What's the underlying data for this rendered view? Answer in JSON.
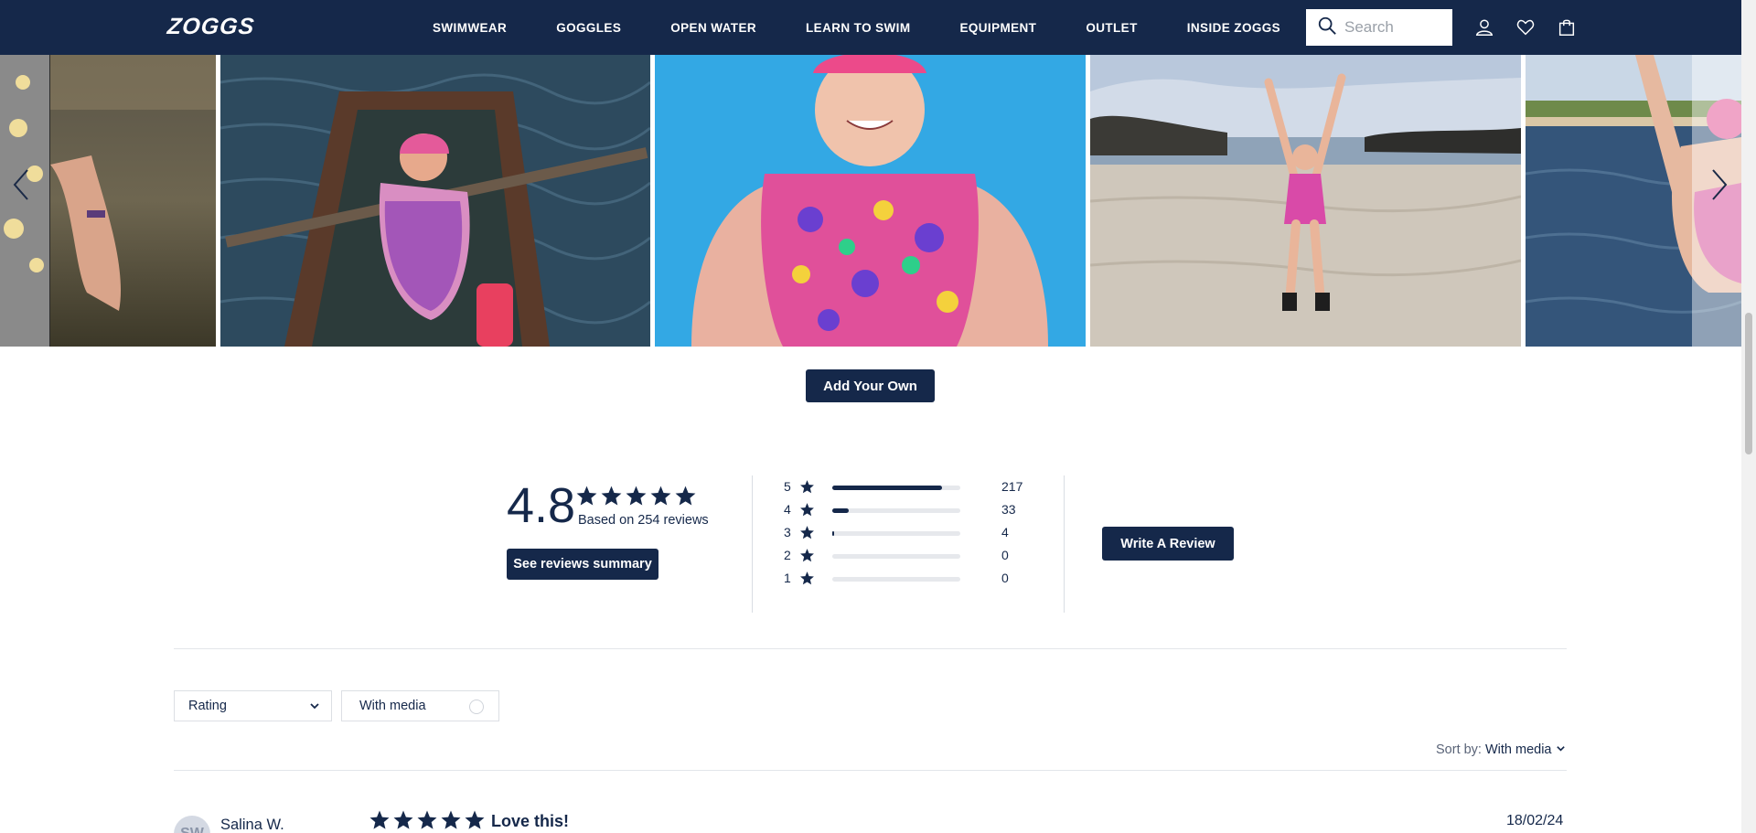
{
  "nav": {
    "logo": "ZOGGS",
    "links": [
      "SWIMWEAR",
      "GOGGLES",
      "OPEN WATER",
      "LEARN TO SWIM",
      "EQUIPMENT",
      "OUTLET",
      "INSIDE ZOGGS"
    ],
    "search_placeholder": "Search",
    "icons": [
      "account-icon",
      "wishlist-heart-icon",
      "bag-icon"
    ]
  },
  "gallery": {
    "add_your_own": "Add Your Own",
    "photos": [
      "customer-photo-1",
      "customer-photo-2",
      "customer-photo-3",
      "customer-photo-4",
      "customer-photo-5"
    ],
    "colors": {
      "water_dark": "#2d4a5e",
      "pool_blue": "#2fa3e0",
      "sky": "#b9c8dc",
      "sand": "#cfc7bb",
      "swimsuit_pink": "#e0509a"
    }
  },
  "summary": {
    "average": "4.8",
    "stars": 5,
    "based_on": "Based on 254 reviews",
    "see_summary": "See reviews summary",
    "write_review": "Write A Review",
    "histogram": [
      {
        "stars": "5",
        "count": "217",
        "fraction": 0.854
      },
      {
        "stars": "4",
        "count": "33",
        "fraction": 0.13
      },
      {
        "stars": "3",
        "count": "4",
        "fraction": 0.016
      },
      {
        "stars": "2",
        "count": "0",
        "fraction": 0
      },
      {
        "stars": "1",
        "count": "0",
        "fraction": 0
      }
    ]
  },
  "filters": {
    "rating": "Rating",
    "with_media": "With media",
    "sort_label": "Sort by:",
    "sort_value": "With media"
  },
  "review": {
    "initials": "SW",
    "name": "Salina W.",
    "stars": 5,
    "title": "Love this!",
    "date": "18/02/24"
  },
  "theme": {
    "navy": "#15284a"
  }
}
